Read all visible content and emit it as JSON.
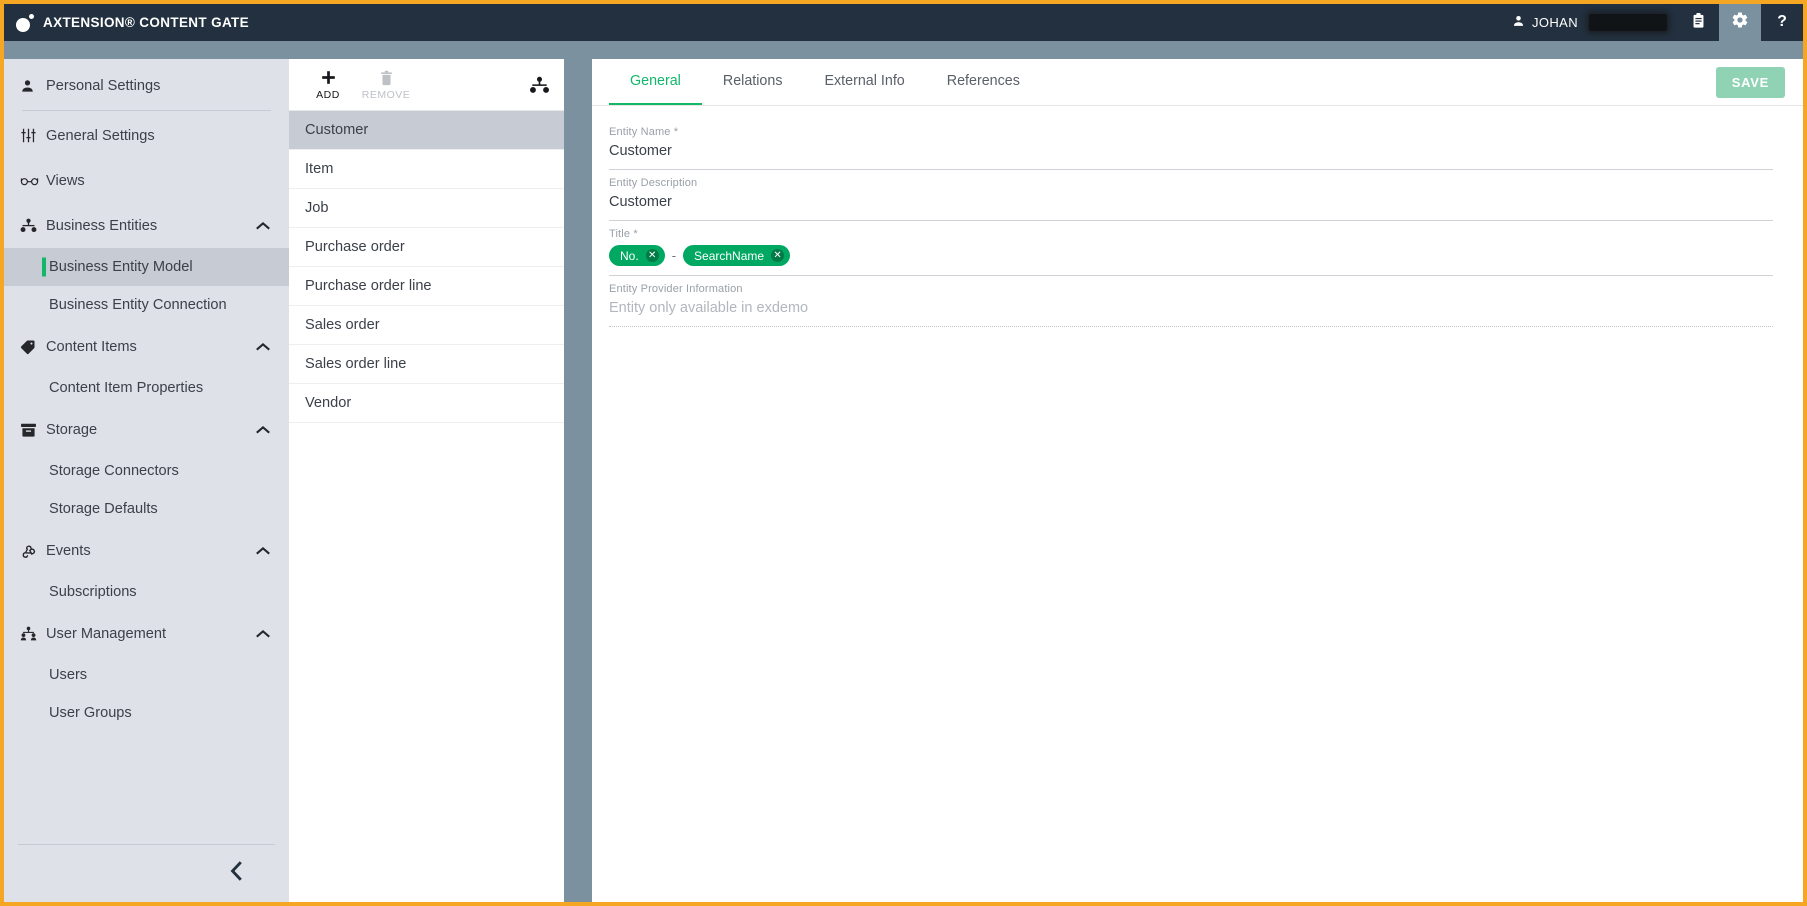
{
  "app": {
    "brand_title": "AXTENSION® CONTENT GATE",
    "accent_green": "#12b76a",
    "chip_green": "#00a862",
    "topbar_bg": "#22303f",
    "page_border": "#f5a623"
  },
  "topbar": {
    "user_label": "JOHAN",
    "user_redacted": true,
    "icons": [
      {
        "name": "clipboard-icon",
        "glyph": "clipboard",
        "active": false
      },
      {
        "name": "gear-icon",
        "glyph": "gear",
        "active": true
      },
      {
        "name": "help-icon",
        "glyph": "?",
        "active": false
      }
    ]
  },
  "sidebar": {
    "items": [
      {
        "label": "Personal Settings",
        "icon": "person-icon",
        "level": "top",
        "caret": false,
        "selected": false,
        "divider_after": true
      },
      {
        "label": "General Settings",
        "icon": "sliders-icon",
        "level": "top",
        "caret": false,
        "selected": false
      },
      {
        "label": "Views",
        "icon": "glasses-icon",
        "level": "top",
        "caret": false,
        "selected": false
      },
      {
        "label": "Business Entities",
        "icon": "entity-node-icon",
        "level": "top",
        "caret": true,
        "selected": false
      },
      {
        "label": "Business Entity Model",
        "level": "child",
        "caret": false,
        "selected": true
      },
      {
        "label": "Business Entity Connection",
        "level": "child",
        "caret": false,
        "selected": false
      },
      {
        "label": "Content Items",
        "icon": "tag-icon",
        "level": "top",
        "caret": true,
        "selected": false
      },
      {
        "label": "Content Item Properties",
        "level": "child",
        "caret": false,
        "selected": false
      },
      {
        "label": "Storage",
        "icon": "archive-icon",
        "level": "top",
        "caret": true,
        "selected": false
      },
      {
        "label": "Storage Connectors",
        "level": "child",
        "caret": false,
        "selected": false
      },
      {
        "label": "Storage Defaults",
        "level": "child",
        "caret": false,
        "selected": false
      },
      {
        "label": "Events",
        "icon": "webhook-icon",
        "level": "top",
        "caret": true,
        "selected": false
      },
      {
        "label": "Subscriptions",
        "level": "child",
        "caret": false,
        "selected": false
      },
      {
        "label": "User Management",
        "icon": "users-group-icon",
        "level": "top",
        "caret": true,
        "selected": false
      },
      {
        "label": "Users",
        "level": "child",
        "caret": false,
        "selected": false
      },
      {
        "label": "User Groups",
        "level": "child",
        "caret": false,
        "selected": false
      }
    ],
    "collapse_icon": "chevron-left-icon"
  },
  "entity_panel": {
    "toolbar": {
      "add_label": "ADD",
      "add_icon": "plus-icon",
      "remove_label": "REMOVE",
      "remove_icon": "trash-icon",
      "remove_disabled": true,
      "right_icon": "entity-node-icon"
    },
    "entities": [
      {
        "name": "Customer",
        "selected": true
      },
      {
        "name": "Item",
        "selected": false
      },
      {
        "name": "Job",
        "selected": false
      },
      {
        "name": "Purchase order",
        "selected": false
      },
      {
        "name": "Purchase order line",
        "selected": false
      },
      {
        "name": "Sales order",
        "selected": false
      },
      {
        "name": "Sales order line",
        "selected": false
      },
      {
        "name": "Vendor",
        "selected": false
      }
    ]
  },
  "main": {
    "tabs": [
      {
        "label": "General",
        "active": true
      },
      {
        "label": "Relations",
        "active": false
      },
      {
        "label": "External Info",
        "active": false
      },
      {
        "label": "References",
        "active": false
      }
    ],
    "save_label": "SAVE",
    "fields": {
      "entity_name": {
        "label": "Entity Name *",
        "value": "Customer"
      },
      "entity_description": {
        "label": "Entity Description",
        "value": "Customer"
      },
      "title": {
        "label": "Title *",
        "separator": "-",
        "chips": [
          {
            "label": "No.",
            "remove_icon": "chip-remove-icon"
          },
          {
            "label": "SearchName",
            "remove_icon": "chip-remove-icon"
          }
        ]
      },
      "provider_info": {
        "label": "Entity Provider Information",
        "value": "Entity only available in exdemo",
        "disabled": true
      }
    }
  }
}
